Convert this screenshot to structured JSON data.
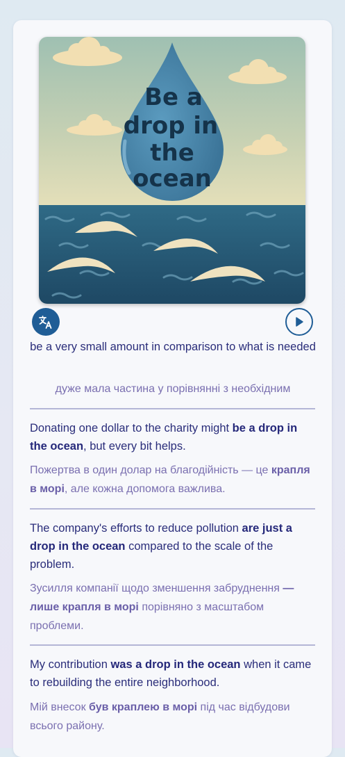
{
  "illustration": {
    "title_lines": [
      "Be a",
      "drop in",
      "the",
      "ocean"
    ],
    "colors": {
      "sky": "#cbd2b0",
      "drop": "#4a85a8",
      "sea": "#2e6580",
      "cloud": "#f2dfb2",
      "text": "#15334a"
    }
  },
  "controls": {
    "translate_icon": "translate-icon",
    "play_icon": "play-icon",
    "accent": "#1f5d96"
  },
  "definition": {
    "en": "be a very small amount in comparison to what is needed",
    "uk": "дуже мала частина у порівнянні з необхідним"
  },
  "examples": [
    {
      "en": [
        {
          "t": "Donating one dollar to the charity might "
        },
        {
          "t": "be a drop in the ocean",
          "b": true
        },
        {
          "t": ", but every bit helps."
        }
      ],
      "uk": [
        {
          "t": "Пожертва в один долар на благодійність — це "
        },
        {
          "t": "крапля в морі",
          "b": true
        },
        {
          "t": ", але кожна допомога важлива."
        }
      ]
    },
    {
      "en": [
        {
          "t": "The company's efforts to reduce pollution "
        },
        {
          "t": "are just a drop in the ocean",
          "b": true
        },
        {
          "t": " compared to the scale of the problem."
        }
      ],
      "uk": [
        {
          "t": "Зусилля компанії щодо зменшення забруднення "
        },
        {
          "t": "— лише крапля в морі",
          "b": true
        },
        {
          "t": " порівняно з масштабом проблеми."
        }
      ]
    },
    {
      "en": [
        {
          "t": "My contribution "
        },
        {
          "t": "was a drop in the ocean",
          "b": true
        },
        {
          "t": " when it came to rebuilding the entire neighborhood."
        }
      ],
      "uk": [
        {
          "t": "Мій внесок "
        },
        {
          "t": "був краплею в морі",
          "b": true
        },
        {
          "t": " під час відбудови всього району."
        }
      ]
    }
  ]
}
